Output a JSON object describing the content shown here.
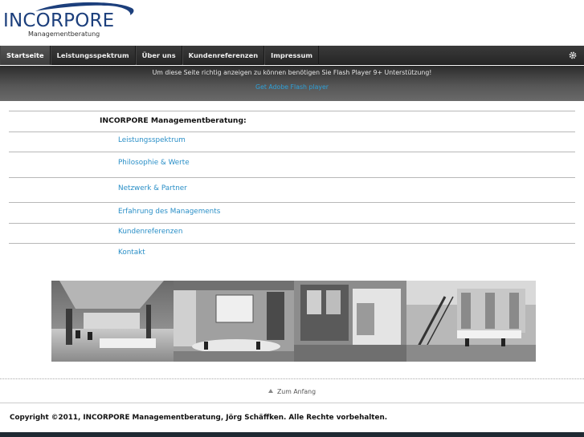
{
  "logo": {
    "name": "INCORPORE",
    "tagline": "Managementberatung"
  },
  "nav": {
    "items": [
      {
        "label": "Startseite",
        "active": true
      },
      {
        "label": "Leistungsspektrum",
        "active": false
      },
      {
        "label": "Über uns",
        "active": false
      },
      {
        "label": "Kundenreferenzen",
        "active": false
      },
      {
        "label": "Impressum",
        "active": false
      }
    ],
    "settings_icon": "gear-icon"
  },
  "flash": {
    "message": "Um diese Seite richtig anzeigen zu können benötigen Sie Flash Player 9+ Unterstützung!",
    "link": "Get Adobe Flash player"
  },
  "main": {
    "heading": "INCORPORE Managementberatung:",
    "links": [
      "Leistungsspektrum",
      "Philosophie & Werte",
      "Netzwerk & Partner",
      "Erfahrung des Managements",
      "Kundenreferenzen",
      "Kontakt"
    ]
  },
  "footer": {
    "to_top": "Zum Anfang",
    "copyright": "Copyright ©2011, INCORPORE Managementberatung, Jörg Schäffken. Alle Rechte vorbehalten."
  },
  "colors": {
    "brand": "#1c3f7c",
    "link": "#2a8fc7",
    "navbar": "#2e2e2e"
  }
}
